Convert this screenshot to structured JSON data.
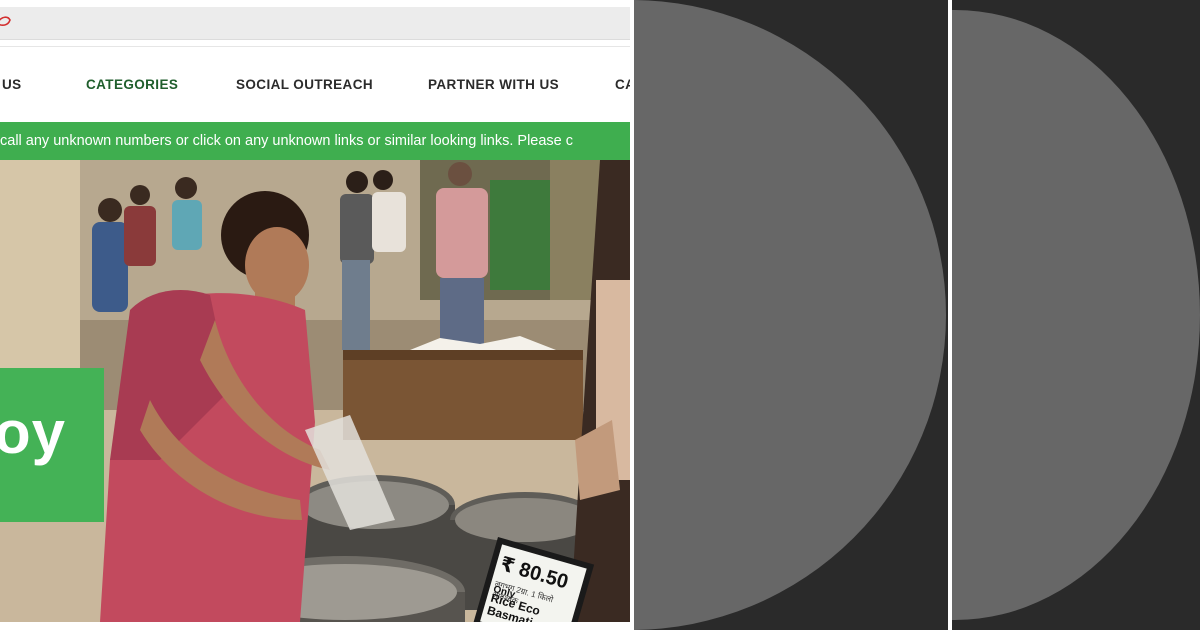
{
  "nav": {
    "items": [
      {
        "label": "US",
        "state": "default"
      },
      {
        "label": "CATEGORIES",
        "state": "active"
      },
      {
        "label": "SOCIAL OUTREACH",
        "state": "default"
      },
      {
        "label": "PARTNER WITH US",
        "state": "default"
      },
      {
        "label": "CA",
        "state": "default"
      }
    ]
  },
  "alert_banner": {
    "text": "call any unknown numbers or click on any unknown links or similar looking links. Please c"
  },
  "hero": {
    "headline_fragment": "oy",
    "price_tag": {
      "price": "₹ 80.50",
      "price_suffix": "Only",
      "hindi_text": "लगभग 2ग्रा. 1 किलो आवश्यक",
      "product_text": "Rice Eco Basmati"
    }
  },
  "colors": {
    "brand_green": "#3fae4f",
    "nav_active": "#1f5e2c",
    "nav_text": "#2b2b2b",
    "dark_panel": "#2a2a2a",
    "disc_grey": "#676767"
  }
}
